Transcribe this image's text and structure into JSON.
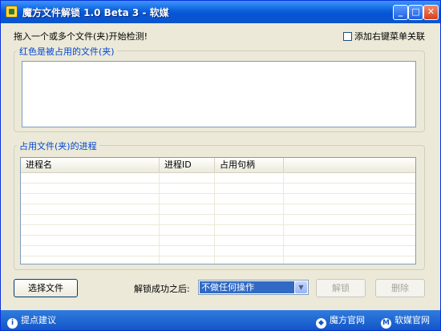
{
  "window": {
    "title": "魔方文件解锁 1.0 Beta 3 - 软媒",
    "minimize_glyph": "_",
    "maximize_glyph": "□",
    "close_glyph": "✕"
  },
  "top": {
    "instruction": "拖入一个或多个文件(夹)开始检测!",
    "context_menu_checkbox": "添加右键菜单关联",
    "context_menu_checked": false
  },
  "locked_files_group": {
    "label": "红色是被占用的文件(夹)"
  },
  "process_group": {
    "label": "占用文件(夹)的进程",
    "columns": [
      "进程名",
      "进程ID",
      "占用句柄",
      ""
    ]
  },
  "actions": {
    "select_file_button": "选择文件",
    "after_unlock_label": "解锁成功之后:",
    "after_unlock_value": "不做任何操作",
    "unlock_button": "解锁",
    "delete_button": "删除"
  },
  "statusbar": {
    "feedback": "提点建议",
    "cube_site": "魔方官网",
    "ruanmei_site": "软媒官网"
  }
}
